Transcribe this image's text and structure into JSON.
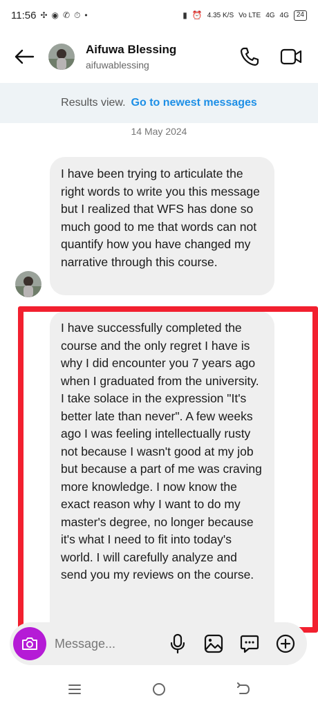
{
  "status_bar": {
    "time": "11:56",
    "net_speed": "4.35 K/S",
    "volte": "Vo LTE",
    "signal_1": "4G",
    "signal_2": "4G",
    "battery": "24"
  },
  "header": {
    "name": "Aifuwa Blessing",
    "username": "aifuwablessing"
  },
  "banner": {
    "text": "Results view.",
    "link": "Go to newest messages"
  },
  "date_separator": "14 May 2024",
  "messages": [
    {
      "text": "I have been trying to articulate the right words to write you this message but I realized that WFS has done so much good to me that words can not quantify how you have changed my narrative through this course."
    },
    {
      "text": "I have successfully completed the course and the only regret I have is why I did encounter you 7 years ago when I graduated from the university. I take solace in the expression \"It's better late than never\". A few weeks ago I was feeling intellectually rusty not because I wasn't good at my job but because a part of me was craving more knowledge. I now know the exact reason why I want to do my master's degree, no longer because it's what I need to fit into today's world. I will carefully analyze and send you my reviews on the course."
    }
  ],
  "composer": {
    "placeholder": "Message..."
  },
  "colors": {
    "accent_link": "#1d8fe6",
    "highlight": "#f2202f",
    "camera_button": "#b51bd6",
    "bubble": "#efefef"
  },
  "icons": [
    "back-arrow-icon",
    "phone-icon",
    "video-icon",
    "camera-icon",
    "microphone-icon",
    "gallery-icon",
    "sticker-icon",
    "plus-icon",
    "menu-icon",
    "home-icon",
    "back-icon"
  ]
}
